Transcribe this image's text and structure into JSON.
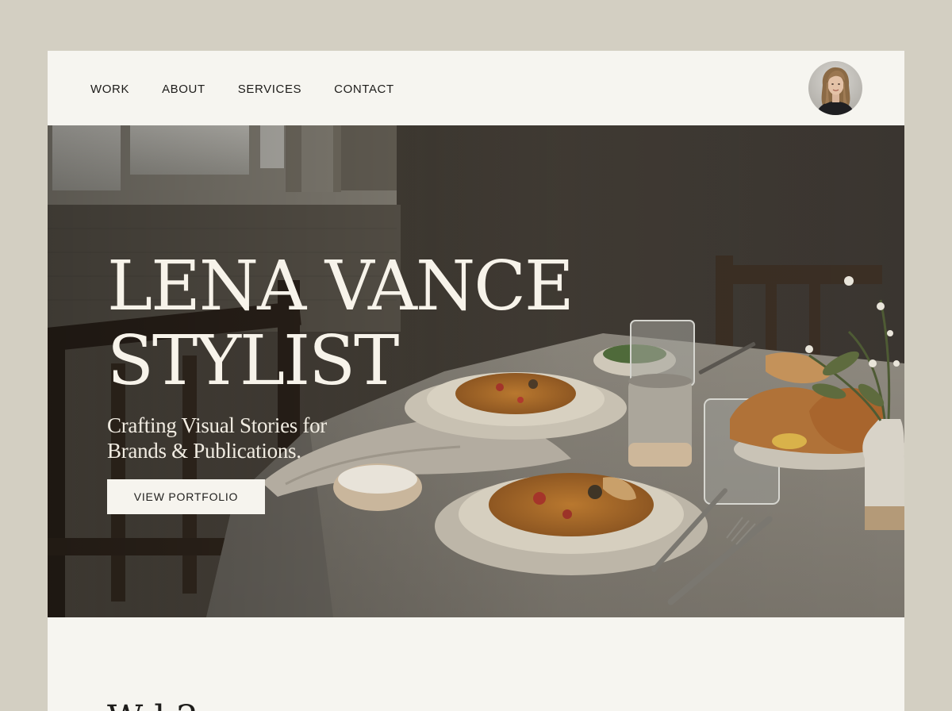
{
  "nav": {
    "items": [
      {
        "label": "WORK"
      },
      {
        "label": "ABOUT"
      },
      {
        "label": "SERVICES"
      },
      {
        "label": "CONTACT"
      }
    ]
  },
  "profile": {
    "avatar_icon": "avatar-photo"
  },
  "hero": {
    "title_line1": "LENA VANCE",
    "title_line2": "STYLIST",
    "subtitle_line1": "Crafting Visual Stories for",
    "subtitle_line2": "Brands & Publications.",
    "cta_label": "VIEW PORTFOLIO"
  },
  "next_section": {
    "heading_partial": "W          l 2"
  },
  "colors": {
    "page_bg": "#d3cfc2",
    "card_bg": "#f6f5f0",
    "hero_text": "#f7f3ea",
    "button_bg": "#f6f4ee",
    "text_dark": "#1d1c1a"
  }
}
